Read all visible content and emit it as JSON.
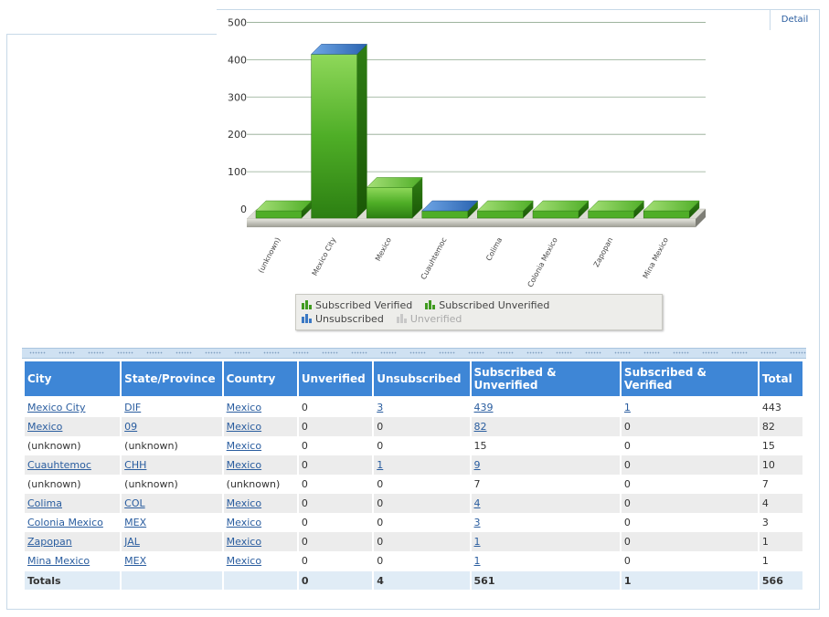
{
  "detail_tab": "Detail",
  "chart_data": {
    "type": "bar",
    "categories": [
      "(unknown)",
      "Mexico City",
      "Mexico",
      "Cuauhtemoc",
      "Colima",
      "Colonia Mexico",
      "Zapopan",
      "Mina Mexico"
    ],
    "series": [
      {
        "name": "Subscribed Verified",
        "values": [
          0,
          1,
          0,
          0,
          0,
          0,
          0,
          0
        ]
      },
      {
        "name": "Subscribed Unverified",
        "values": [
          15,
          439,
          82,
          9,
          4,
          3,
          1,
          1
        ]
      },
      {
        "name": "Unsubscribed",
        "values": [
          0,
          3,
          0,
          1,
          0,
          0,
          0,
          0
        ]
      },
      {
        "name": "Unverified",
        "values": [
          0,
          0,
          0,
          0,
          0,
          0,
          0,
          0
        ]
      }
    ],
    "y_ticks": [
      "0",
      "100",
      "200",
      "300",
      "400",
      "500"
    ],
    "ylim": [
      0,
      500
    ],
    "grid": true,
    "legend_position": "bottom",
    "colors": {
      "green": "#3f9a1e",
      "blue": "#3a78c4",
      "gray": "#c8c8c8"
    }
  },
  "table": {
    "headers": [
      "City",
      "State/Province",
      "Country",
      "Unverified",
      "Unsubscribed",
      "Subscribed & Unverified",
      "Subscribed & Verified",
      "Total"
    ],
    "rows": [
      [
        "Mexico City",
        "DIF",
        "Mexico",
        "0",
        "3",
        "439",
        "1",
        "443"
      ],
      [
        "Mexico",
        "09",
        "Mexico",
        "0",
        "0",
        "82",
        "0",
        "82"
      ],
      [
        "(unknown)",
        "(unknown)",
        "Mexico",
        "0",
        "0",
        "15",
        "0",
        "15"
      ],
      [
        "Cuauhtemoc",
        "CHH",
        "Mexico",
        "0",
        "1",
        "9",
        "0",
        "10"
      ],
      [
        "(unknown)",
        "(unknown)",
        "(unknown)",
        "0",
        "0",
        "7",
        "0",
        "7"
      ],
      [
        "Colima",
        "COL",
        "Mexico",
        "0",
        "0",
        "4",
        "0",
        "4"
      ],
      [
        "Colonia Mexico",
        "MEX",
        "Mexico",
        "0",
        "0",
        "3",
        "0",
        "3"
      ],
      [
        "Zapopan",
        "JAL",
        "Mexico",
        "0",
        "0",
        "1",
        "0",
        "1"
      ],
      [
        "Mina Mexico",
        "MEX",
        "Mexico",
        "0",
        "0",
        "1",
        "0",
        "1"
      ]
    ],
    "links": [
      [
        true,
        true,
        true,
        false,
        true,
        true,
        true,
        false
      ],
      [
        true,
        true,
        true,
        false,
        false,
        true,
        false,
        false
      ],
      [
        false,
        false,
        true,
        false,
        false,
        false,
        false,
        false
      ],
      [
        true,
        true,
        true,
        false,
        true,
        true,
        false,
        false
      ],
      [
        false,
        false,
        false,
        false,
        false,
        false,
        false,
        false
      ],
      [
        true,
        true,
        true,
        false,
        false,
        true,
        false,
        false
      ],
      [
        true,
        true,
        true,
        false,
        false,
        true,
        false,
        false
      ],
      [
        true,
        true,
        true,
        false,
        false,
        true,
        false,
        false
      ],
      [
        true,
        true,
        true,
        false,
        false,
        true,
        false,
        false
      ]
    ],
    "totals": [
      "Totals",
      "",
      "",
      "0",
      "4",
      "561",
      "1",
      "566"
    ]
  }
}
